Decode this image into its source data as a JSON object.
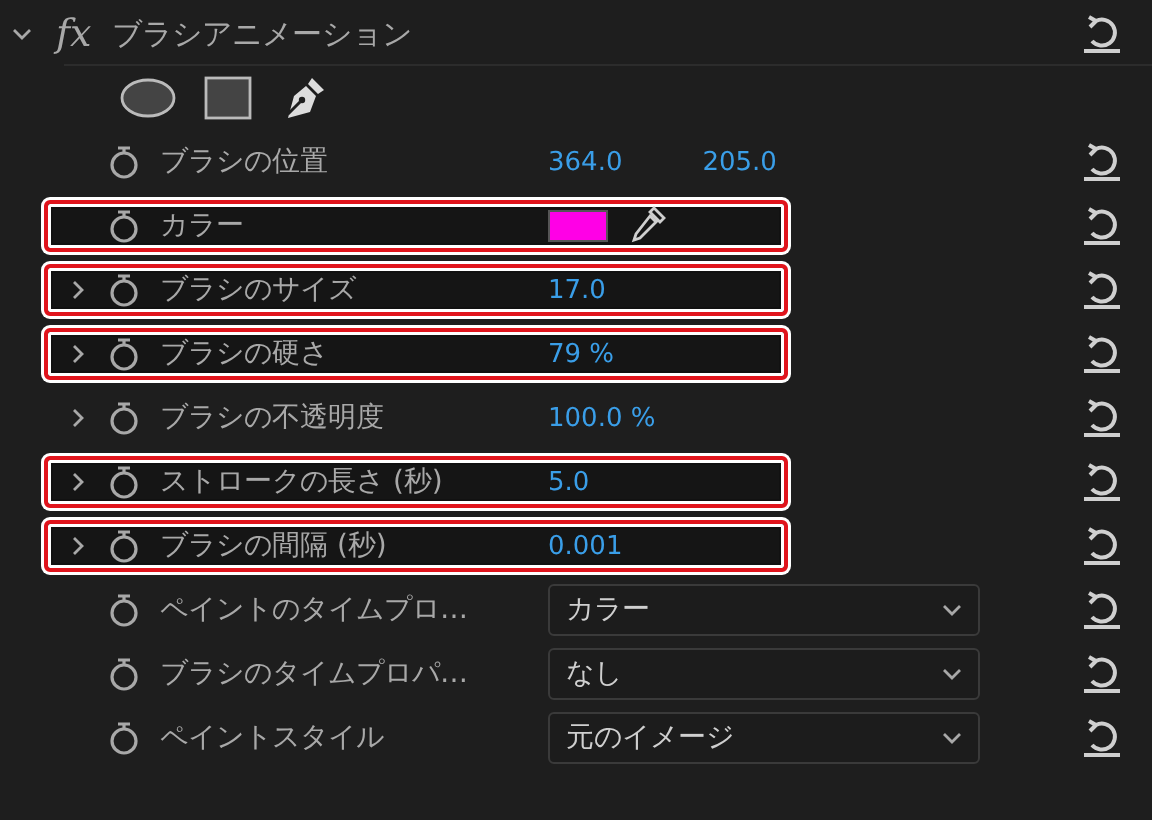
{
  "effect": {
    "title": "ブラシアニメーション",
    "expanded": true,
    "fx": "fx"
  },
  "rows": [
    {
      "kind": "pair",
      "label": "ブラシの位置",
      "values": [
        "364.0",
        "205.0"
      ],
      "expandable": false,
      "highlighted": false
    },
    {
      "kind": "color",
      "label": "カラー",
      "color": "#ff00e6",
      "expandable": false,
      "highlighted": true
    },
    {
      "kind": "value",
      "label": "ブラシのサイズ",
      "value": "17.0",
      "expandable": true,
      "highlighted": true
    },
    {
      "kind": "value",
      "label": "ブラシの硬さ",
      "value": "79 %",
      "expandable": true,
      "highlighted": true
    },
    {
      "kind": "value",
      "label": "ブラシの不透明度",
      "value": "100.0 %",
      "expandable": true,
      "highlighted": false
    },
    {
      "kind": "value",
      "label": "ストロークの長さ (秒)",
      "value": "5.0",
      "expandable": true,
      "highlighted": true
    },
    {
      "kind": "value",
      "label": "ブラシの間隔 (秒)",
      "value": "0.001",
      "expandable": true,
      "highlighted": true
    },
    {
      "kind": "dropdown",
      "label": "ペイントのタイムプロ…",
      "value": "カラー",
      "expandable": false,
      "highlighted": false
    },
    {
      "kind": "dropdown",
      "label": "ブラシのタイムプロパ…",
      "value": "なし",
      "expandable": false,
      "highlighted": false
    },
    {
      "kind": "dropdown",
      "label": "ペイントスタイル",
      "value": "元のイメージ",
      "expandable": false,
      "highlighted": false
    }
  ]
}
